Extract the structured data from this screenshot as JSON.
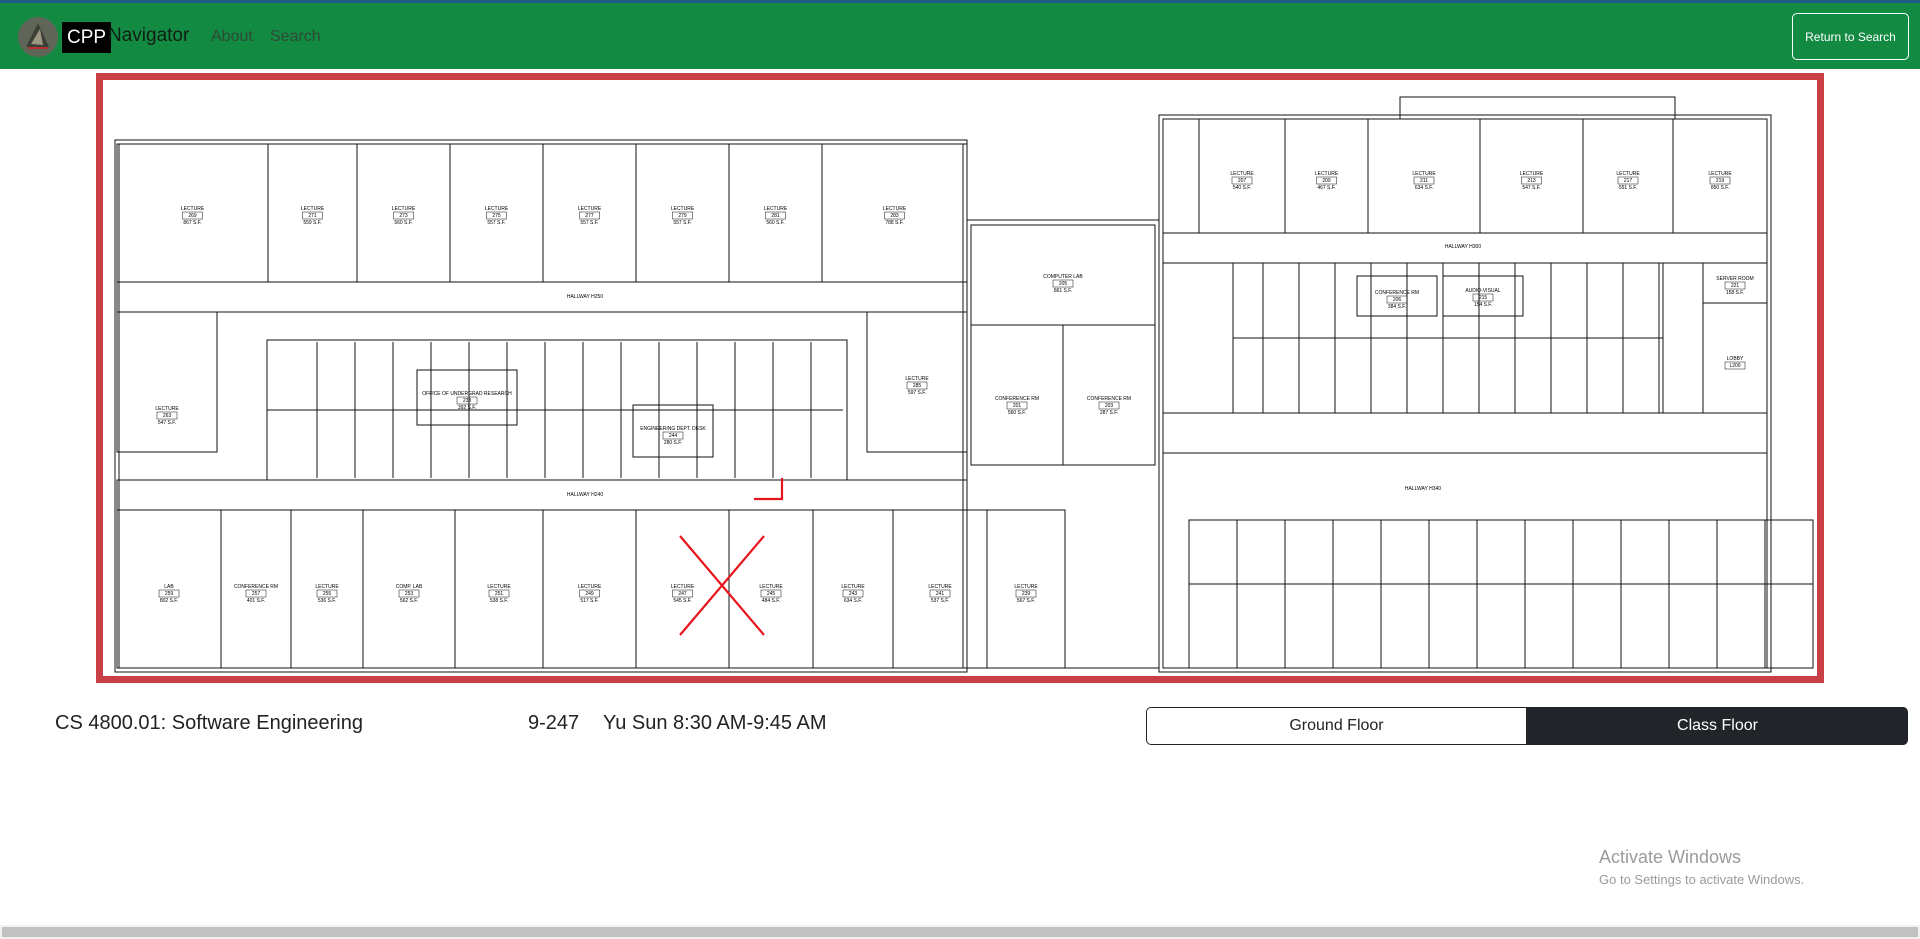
{
  "navbar": {
    "brand_box": "CPP",
    "brand_text": "Navigator",
    "links": [
      "About",
      "Search"
    ],
    "return_label": "Return to Search",
    "bg_color": "#138a42"
  },
  "map": {
    "border_color": "#c83f45",
    "marker_color": "#e8141c",
    "rooms_top_left": [
      {
        "name": "LECTURE",
        "num": "269",
        "sf": "867 S.F."
      },
      {
        "name": "LECTURE",
        "num": "271",
        "sf": "559 S.F."
      },
      {
        "name": "LECTURE",
        "num": "273",
        "sf": "560 S.F."
      },
      {
        "name": "LECTURE",
        "num": "275",
        "sf": "557 S.F."
      },
      {
        "name": "LECTURE",
        "num": "277",
        "sf": "557 S.F."
      },
      {
        "name": "LECTURE",
        "num": "279",
        "sf": "557 S.F."
      },
      {
        "name": "LECTURE",
        "num": "281",
        "sf": "560 S.F."
      },
      {
        "name": "LECTURE",
        "num": "283",
        "sf": "788 S.F."
      }
    ],
    "rooms_top_right": [
      {
        "name": "LECTURE",
        "num": "207",
        "sf": "540 S.F."
      },
      {
        "name": "LECTURE",
        "num": "209",
        "sf": "467 S.F."
      },
      {
        "name": "LECTURE",
        "num": "211",
        "sf": "634 S.F."
      },
      {
        "name": "LECTURE",
        "num": "213",
        "sf": "547 S.F."
      },
      {
        "name": "LECTURE",
        "num": "217",
        "sf": "551 S.F."
      },
      {
        "name": "LECTURE",
        "num": "219",
        "sf": "850 S.F."
      }
    ],
    "rooms_bottom_left": [
      {
        "name": "LAB",
        "num": "259",
        "sf": "802 S.F."
      },
      {
        "name": "CONFERENCE RM",
        "num": "257",
        "sf": "401 S.F."
      },
      {
        "name": "LECTURE",
        "num": "255",
        "sf": "536 S.F."
      },
      {
        "name": "COMP. LAB",
        "num": "253",
        "sf": "562 S.F."
      },
      {
        "name": "LECTURE",
        "num": "251",
        "sf": "538 S.F."
      },
      {
        "name": "LECTURE",
        "num": "249",
        "sf": "517 S.F."
      },
      {
        "name": "LECTURE",
        "num": "247",
        "sf": "545 S.F."
      },
      {
        "name": "LECTURE",
        "num": "245",
        "sf": "484 S.F."
      },
      {
        "name": "LECTURE",
        "num": "243",
        "sf": "634 S.F."
      },
      {
        "name": "LECTURE",
        "num": "241",
        "sf": "537 S.F."
      },
      {
        "name": "LECTURE",
        "num": "239",
        "sf": "567 S.F."
      }
    ],
    "middle_rooms": [
      {
        "name": "COMPUTER LAB",
        "num": "205",
        "sf": "861 S.F."
      },
      {
        "name": "CONFERENCE RM",
        "num": "201",
        "sf": "560 S.F."
      },
      {
        "name": "CONFERENCE RM",
        "num": "203",
        "sf": "287 S.F."
      },
      {
        "name": "LECTURE",
        "num": "285",
        "sf": "597 S.F."
      },
      {
        "name": "LECTURE",
        "num": "263",
        "sf": "547 S.F."
      },
      {
        "name": "OFFICE OF UNDERGRAD RESEARCH",
        "num": "238",
        "sf": "392 S.F."
      },
      {
        "name": "ENGINEERING DEPT. DESK",
        "num": "244",
        "sf": "280 S.F."
      },
      {
        "name": "AUDIO-VISUAL",
        "num": "215",
        "sf": "154 S.F."
      },
      {
        "name": "CONFERENCE RM",
        "num": "206",
        "sf": "384 S.F."
      },
      {
        "name": "SERVER ROOM",
        "num": "221",
        "sf": "158 S.F."
      },
      {
        "name": "LOBBY",
        "num": "L200",
        "sf": ""
      }
    ],
    "hallways": [
      "HALLWAY",
      "H250",
      "H240",
      "H300",
      "H340",
      "H260",
      "H230"
    ]
  },
  "info": {
    "course": "CS 4800.01: Software Engineering",
    "room": "9-247",
    "schedule": "Yu Sun 8:30 AM-9:45 AM"
  },
  "floor_toggle": {
    "ground_label": "Ground Floor",
    "class_label": "Class Floor",
    "active": "Class Floor"
  },
  "watermark": {
    "title": "Activate Windows",
    "subtitle": "Go to Settings to activate Windows."
  }
}
